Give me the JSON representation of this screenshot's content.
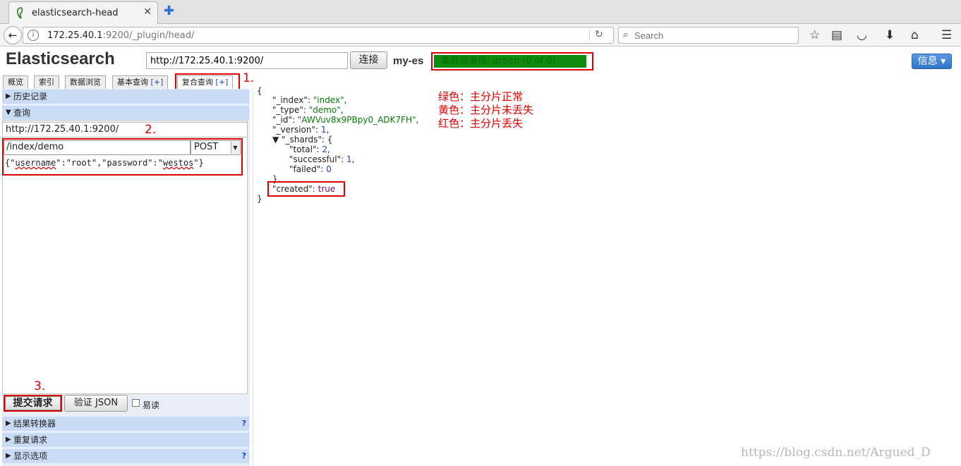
{
  "browser": {
    "tab_title": "elasticsearch-head",
    "url_host": "172.25.40.1",
    "url_rest": ":9200/_plugin/head/",
    "search_placeholder": "Search"
  },
  "header": {
    "app_title": "Elasticsearch",
    "connect_url": "http://172.25.40.1:9200/",
    "connect_label": "连接",
    "cluster_name": "my-es",
    "health_text": "集群健康值: green (0 of 0)",
    "info_label": "信息 ▾"
  },
  "tabs": [
    {
      "label": "概览"
    },
    {
      "label": "索引"
    },
    {
      "label": "数据浏览"
    },
    {
      "label": "基本查询",
      "plus": "[+]"
    },
    {
      "label": "复合查询",
      "plus": "[+]"
    }
  ],
  "left": {
    "history_label": "历史记录",
    "query_label": "查询",
    "base_url": "http://172.25.40.1:9200/",
    "path": "/index/demo",
    "method": "POST",
    "body_parts": [
      "{\"",
      "username",
      "\":\"root\",\"password\":\"",
      "westos",
      "\"}"
    ],
    "submit_label": "提交请求",
    "validate_label": "验证 JSON",
    "pretty_label": "易读",
    "transformer_label": "结果转换器",
    "repeat_label": "重复请求",
    "display_label": "显示选项",
    "help": "?"
  },
  "annotations": {
    "step1": "1.",
    "step2": "2.",
    "step3": "3."
  },
  "result": {
    "open": "{",
    "index_key": "\"_index\": ",
    "index_val": "\"index\"",
    "type_key": "\"_type\": ",
    "type_val": "\"demo\"",
    "id_key": "\"_id\": ",
    "id_val": "\"AWVuv8x9PBpy0_ADK7FH\"",
    "version_key": "\"_version\": ",
    "version_val": "1",
    "shards_key": "\"_shards\": {",
    "total_key": "\"total\": ",
    "total_val": "2",
    "successful_key": "\"successful\": ",
    "successful_val": "1",
    "failed_key": "\"failed\": ",
    "failed_val": "0",
    "shards_close": "},",
    "created_key": "\"created\": ",
    "created_val": "true",
    "close": "}"
  },
  "legend": {
    "green": "绿色：主分片正常",
    "yellow": "黄色：主分片未丢失",
    "red": "红色：主分片丢失"
  },
  "watermark": "https://blog.csdn.net/Argued_D",
  "colors": {
    "accent_red": "#dd0000",
    "health_green": "#0e8a0e",
    "section_blue": "#c9dcf6"
  }
}
